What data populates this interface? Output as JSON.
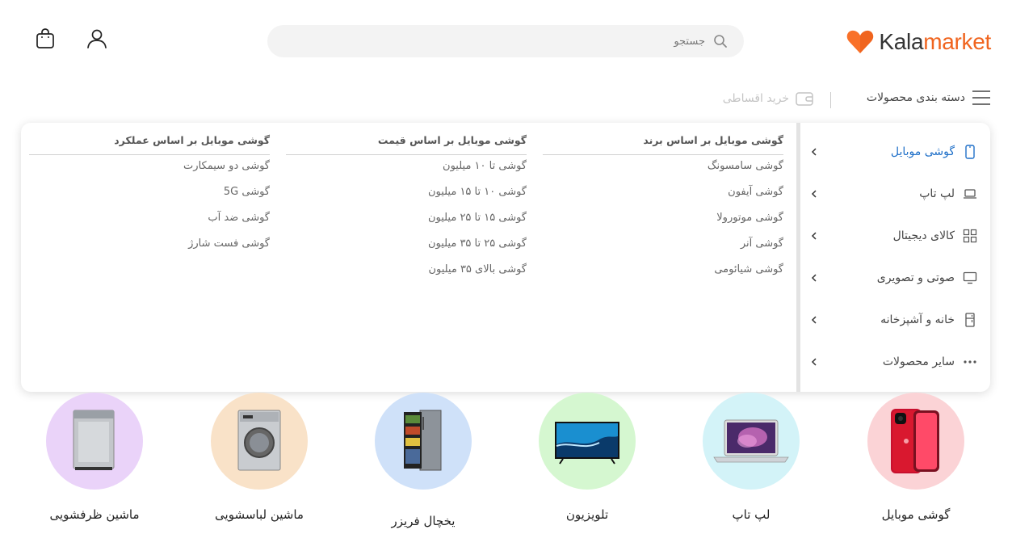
{
  "logo": {
    "part1": "Kala",
    "part2": "market",
    "accent_color": "#f0641e"
  },
  "search": {
    "placeholder": "جستجو",
    "icon": "search-icon"
  },
  "header_icons": {
    "user": "user-icon",
    "cart": "shopping-bag-icon"
  },
  "nav": {
    "categories_label": "دسته بندی محصولات",
    "installment_label": "خرید اقساطی"
  },
  "mega_menu": {
    "sidebar": [
      {
        "label": "گوشی موبایل",
        "icon": "mobile-icon",
        "active": true
      },
      {
        "label": "لپ تاپ",
        "icon": "laptop-icon",
        "active": false
      },
      {
        "label": "کالای دیجیتال",
        "icon": "grid-icon",
        "active": false
      },
      {
        "label": "صوتی و تصویری",
        "icon": "monitor-icon",
        "active": false
      },
      {
        "label": "خانه و آشپزخانه",
        "icon": "fridge-icon",
        "active": false
      },
      {
        "label": "سایر محصولات",
        "icon": "more-dots-icon",
        "active": false
      }
    ],
    "columns": [
      {
        "title": "گوشی موبایل بر اساس برند",
        "links": [
          "گوشی سامسونگ",
          "گوشی آیفون",
          "گوشی موتورولا",
          "گوشی آنر",
          "گوشی شیائومی"
        ]
      },
      {
        "title": "گوشی موبایل بر اساس قیمت",
        "links": [
          "گوشی تا ۱۰ میلیون",
          "گوشی ۱۰ تا ۱۵ میلیون",
          "گوشی ۱۵ تا ۲۵ میلیون",
          "گوشی ۲۵ تا ۳۵ میلیون",
          "گوشی بالای ۳۵ میلیون"
        ]
      },
      {
        "title": "گوشی موبایل بر اساس عملکرد",
        "links": [
          "گوشی دو سیمکارت",
          "گوشی 5G",
          "گوشی ضد آب",
          "گوشی فست شارژ"
        ]
      }
    ]
  },
  "categories": [
    {
      "label": "گوشی موبایل",
      "color": "#fbd3d6"
    },
    {
      "label": "لپ تاپ",
      "color": "#d3f3f8"
    },
    {
      "label": "تلویزیون",
      "color": "#d5f7d0"
    },
    {
      "label": "یخچال فریزر",
      "color": "#cfe1f9"
    },
    {
      "label": "ماشین لباسشویی",
      "color": "#f9e2c8"
    },
    {
      "label": "ماشین ظرفشویی",
      "color": "#ead3f9"
    }
  ]
}
